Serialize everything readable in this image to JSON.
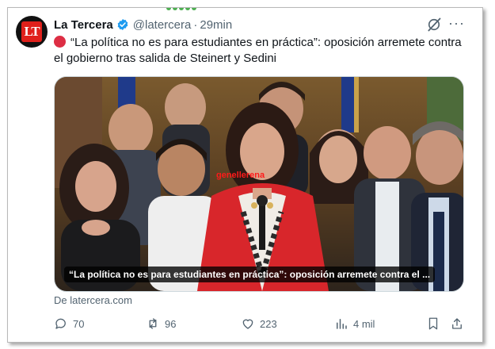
{
  "tweet": {
    "author_name": "La Tercera",
    "handle": "@latercera",
    "separator": "·",
    "time": "29min",
    "avatar_text": "LT",
    "text": "“La política no es para estudiantes en práctica”: oposición arremete contra el gobierno tras salida de Steinert y Sedini",
    "image_caption": "“La política no es para estudiantes en práctica”: oposición arremete contra el ...",
    "image_watermark": "genellerena",
    "source": "De latercera.com",
    "more_label": "···"
  },
  "actions": {
    "replies": "70",
    "reposts": "96",
    "likes": "223",
    "views": "4 mil"
  },
  "colors": {
    "text": "#0f1419",
    "secondary": "#536471",
    "verified": "#1d9bf0",
    "emoji_red": "#dd2e44",
    "brand_red": "#e0201b",
    "jacket_red": "#d8262b"
  },
  "icons": [
    "verified-badge-icon",
    "grok-icon",
    "more-icon",
    "reply-icon",
    "repost-icon",
    "like-icon",
    "views-icon",
    "bookmark-icon",
    "share-icon"
  ]
}
